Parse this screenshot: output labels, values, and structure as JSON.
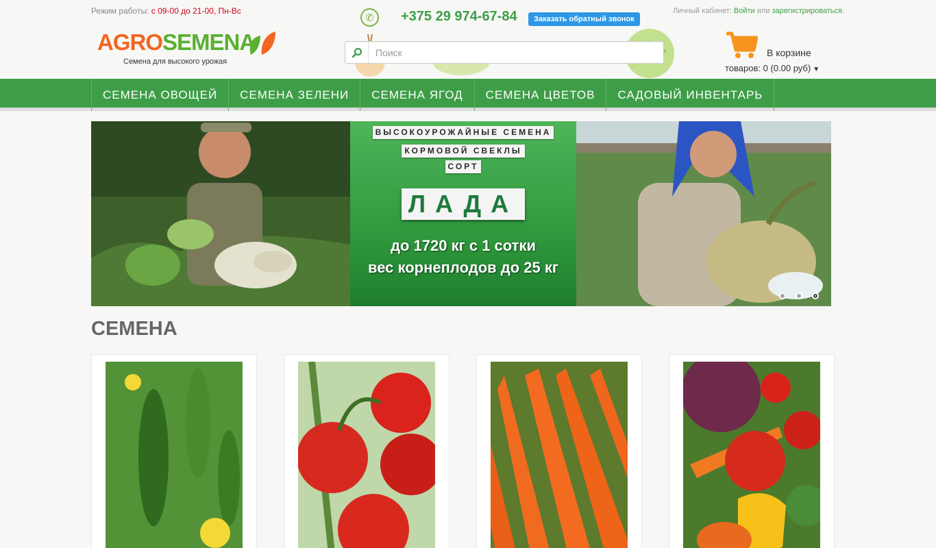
{
  "header": {
    "hours_label": "Режим работы:",
    "hours_time": "с 09-00 до 21-00,",
    "hours_days": "Пн-Вс",
    "phone": "+375 29 974-67-84",
    "callback_button": "Заказать обратный звонок",
    "account_label": "Личный кабинет:",
    "login_link": "Войти",
    "or_text": "или",
    "register_link": "зарегистрироваться",
    "logo_part1": "AGRO",
    "logo_part2": "SEMENA",
    "tagline": "Семена для высокого урожая"
  },
  "search": {
    "placeholder": "Поиск"
  },
  "cart": {
    "title": "В корзине",
    "summary": "товаров: 0 (0.00 руб)"
  },
  "nav": {
    "items": [
      "Семена овощей",
      "Семена зелени",
      "Семена ягод",
      "Семена цветов",
      "Садовый инвентарь"
    ]
  },
  "slider": {
    "line1": "ВЫСОКОУРОЖАЙНЫЕ СЕМЕНА",
    "line2": "КОРМОВОЙ СВЕКЛЫ",
    "line3": "СОРТ",
    "variety": "ЛАДА",
    "yield_text": "до 1720 кг с 1 сотки",
    "weight_text": "вес корнеплодов до 25 кг",
    "dots": 3,
    "active_dot": 3
  },
  "section": {
    "title": "СЕМЕНА"
  },
  "products": [
    {
      "name": "cucumber"
    },
    {
      "name": "tomato"
    },
    {
      "name": "carrot"
    },
    {
      "name": "mixed-vegetables"
    }
  ],
  "colors": {
    "brand_green": "#3e9e48",
    "brand_orange": "#f26522",
    "callback_blue": "#2e97e6"
  }
}
